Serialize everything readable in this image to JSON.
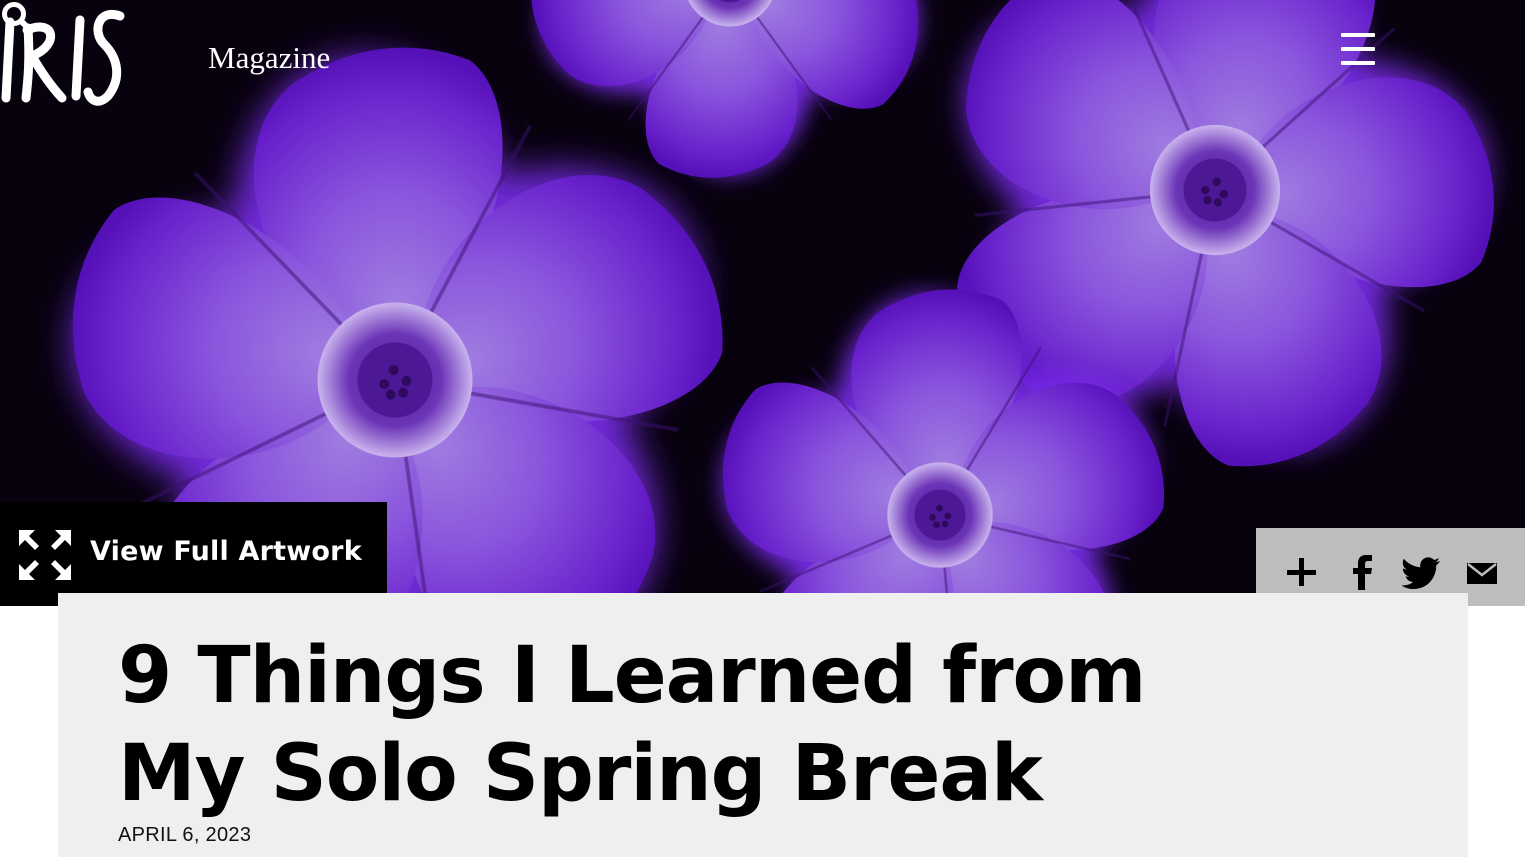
{
  "header": {
    "logo_text": "IRIS",
    "magazine_label": "Magazine",
    "menu_icon": "hamburger-menu-icon",
    "search_icon": "search-icon"
  },
  "hero": {
    "view_full_label": "View Full Artwork",
    "expand_icon": "expand-arrows-icon"
  },
  "share": {
    "icons": [
      "plus-icon",
      "facebook-icon",
      "twitter-icon",
      "email-icon"
    ]
  },
  "article": {
    "title": "9 Things I Learned from My Solo Spring Break",
    "date": "APRIL 6, 2023"
  },
  "colors": {
    "flower_purple": "#7a35d6",
    "flower_light": "#c4a3ee",
    "card_bg": "#efefef",
    "share_bg": "#bdbdbd"
  }
}
